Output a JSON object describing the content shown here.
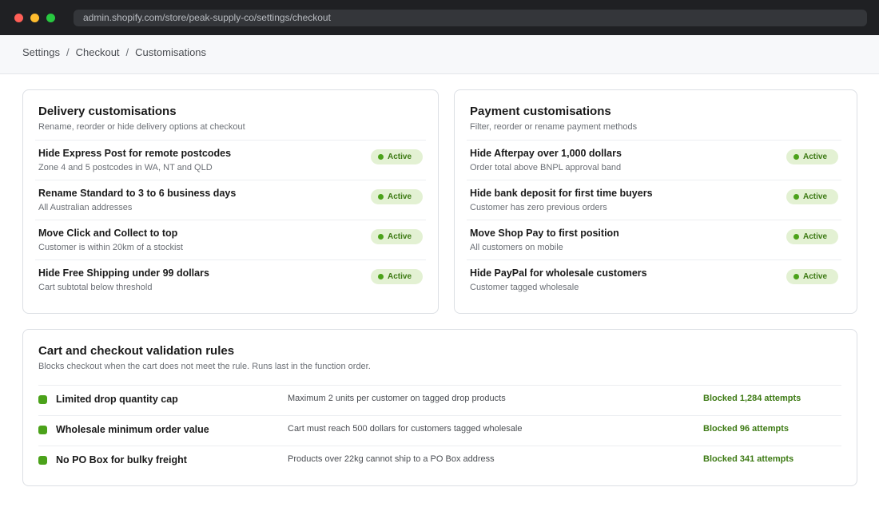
{
  "browser": {
    "url": "admin.shopify.com/store/peak-supply-co/settings/checkout"
  },
  "breadcrumb": [
    "Settings",
    "Checkout",
    "Customisations"
  ],
  "delivery": {
    "title": "Delivery customisations",
    "subtitle": "Rename, reorder or hide delivery options at checkout",
    "items": [
      {
        "title": "Hide Express Post for remote postcodes",
        "desc": "Zone 4 and 5 postcodes in WA, NT and QLD",
        "status": "Active"
      },
      {
        "title": "Rename Standard to 3 to 6 business days",
        "desc": "All Australian addresses",
        "status": "Active"
      },
      {
        "title": "Move Click and Collect to top",
        "desc": "Customer is within 20km of a stockist",
        "status": "Active"
      },
      {
        "title": "Hide Free Shipping under 99 dollars",
        "desc": "Cart subtotal below threshold",
        "status": "Active"
      }
    ]
  },
  "payment": {
    "title": "Payment customisations",
    "subtitle": "Filter, reorder or rename payment methods",
    "items": [
      {
        "title": "Hide Afterpay over 1,000 dollars",
        "desc": "Order total above BNPL approval band",
        "status": "Active"
      },
      {
        "title": "Hide bank deposit for first time buyers",
        "desc": "Customer has zero previous orders",
        "status": "Active"
      },
      {
        "title": "Move Shop Pay to first position",
        "desc": "All customers on mobile",
        "status": "Active"
      },
      {
        "title": "Hide PayPal for wholesale customers",
        "desc": "Customer tagged wholesale",
        "status": "Active"
      }
    ]
  },
  "validation": {
    "title": "Cart and checkout validation rules",
    "subtitle": "Blocks checkout when the cart does not meet the rule. Runs last in the function order.",
    "rules": [
      {
        "name": "Limited drop quantity cap",
        "desc": "Maximum 2 units per customer on tagged drop products",
        "stat": "Blocked 1,284 attempts"
      },
      {
        "name": "Wholesale minimum order value",
        "desc": "Cart must reach 500 dollars for customers tagged wholesale",
        "stat": "Blocked 96 attempts"
      },
      {
        "name": "No PO Box for bulky freight",
        "desc": "Products over 22kg cannot ship to a PO Box address",
        "stat": "Blocked 341 attempts"
      }
    ]
  },
  "colors": {
    "active_badge_bg": "#e3f1d3",
    "active_text": "#3d7a14",
    "status_dot": "#4ba21a"
  }
}
